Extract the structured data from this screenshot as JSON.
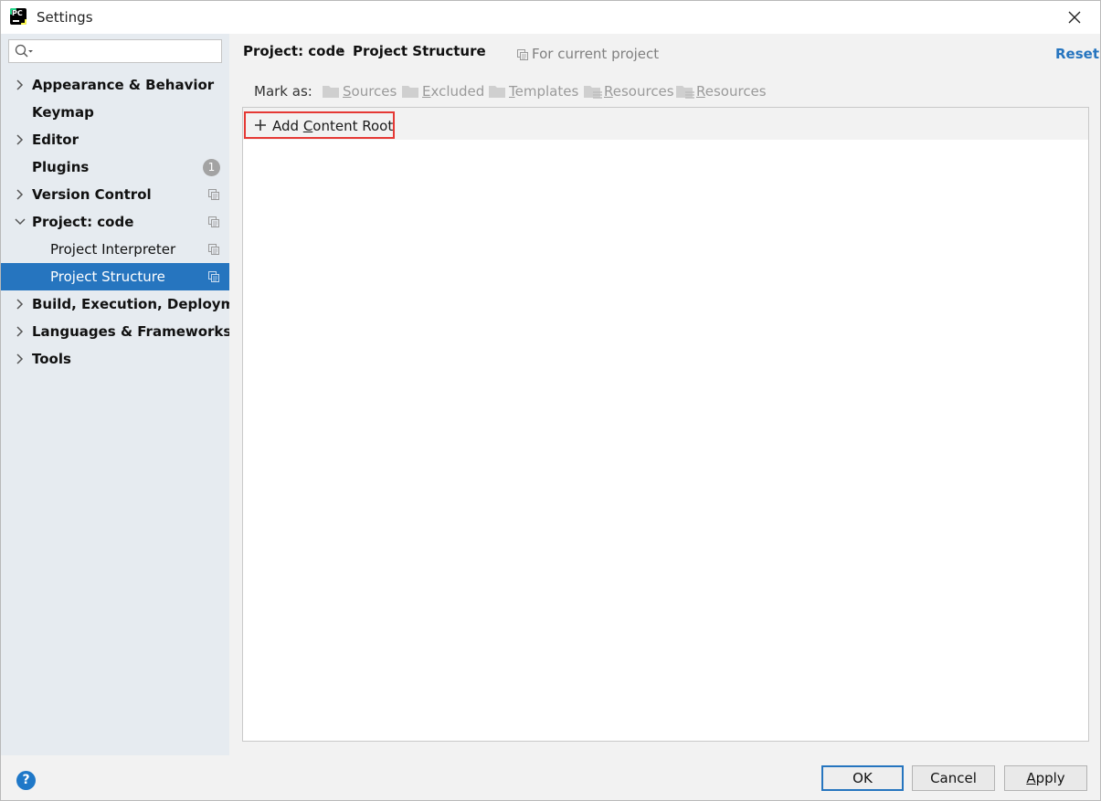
{
  "window": {
    "title": "Settings"
  },
  "search": {
    "placeholder": ""
  },
  "sidebar": {
    "items": [
      {
        "label": "Appearance & Behavior"
      },
      {
        "label": "Keymap"
      },
      {
        "label": "Editor"
      },
      {
        "label": "Plugins",
        "badge": "1"
      },
      {
        "label": "Version Control"
      },
      {
        "label": "Project: code"
      },
      {
        "label": "Project Interpreter"
      },
      {
        "label": "Project Structure"
      },
      {
        "label": "Build, Execution, Deployment"
      },
      {
        "label": "Languages & Frameworks"
      },
      {
        "label": "Tools"
      }
    ]
  },
  "header": {
    "crumb_parent": "Project: code",
    "crumb_separator": "›",
    "crumb_current": "Project Structure",
    "scope_label": "For current project",
    "reset_label": "Reset"
  },
  "markas": {
    "label": "Mark as:",
    "sources": {
      "mnemonic": "S",
      "rest": "ources"
    },
    "excluded": {
      "mnemonic": "E",
      "rest": "xcluded"
    },
    "templates": {
      "mnemonic": "T",
      "rest": "emplates"
    },
    "resources": {
      "mnemonic": "R",
      "rest": "esources"
    },
    "test_resources": {
      "mnemonic": "R",
      "rest": "esources"
    }
  },
  "content": {
    "add_root": {
      "pre": "Add ",
      "mnemonic": "C",
      "rest": "ontent Root"
    }
  },
  "footer": {
    "help": "?",
    "ok": "OK",
    "cancel": "Cancel",
    "apply": {
      "mnemonic": "A",
      "rest": "pply"
    }
  },
  "colors": {
    "accent": "#2675bf",
    "highlight_box": "#e53935",
    "sidebar_bg": "#e6ebf0"
  }
}
